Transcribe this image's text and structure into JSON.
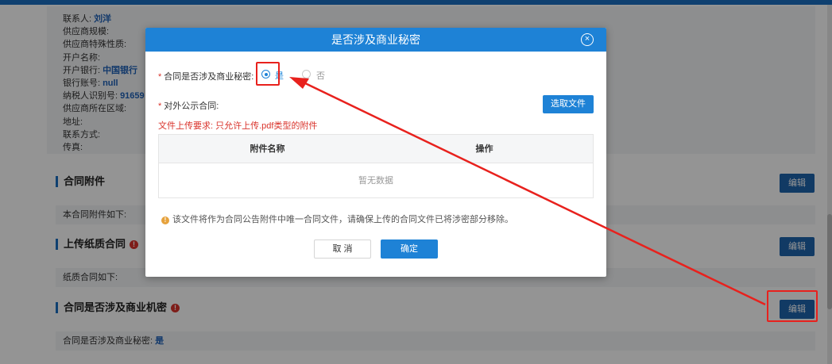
{
  "supplier_info": {
    "rows": [
      {
        "label": "联系人:",
        "value": "刘洋"
      },
      {
        "label": "供应商规模:",
        "value": ""
      },
      {
        "label": "供应商特殊性质:",
        "value": ""
      },
      {
        "label": "开户名称:",
        "value": ""
      },
      {
        "label": "开户银行:",
        "value": "中国银行"
      },
      {
        "label": "银行账号:",
        "value": "null"
      },
      {
        "label": "纳税人识别号:",
        "value": "91659"
      },
      {
        "label": "供应商所在区域:",
        "value": ""
      },
      {
        "label": "地址:",
        "value": ""
      },
      {
        "label": "联系方式:",
        "value": ""
      },
      {
        "label": "传真:",
        "value": ""
      }
    ]
  },
  "sections": {
    "attachments": {
      "title": "合同附件",
      "edit_label": "编辑",
      "summary": "本合同附件如下:"
    },
    "paper_contract": {
      "title": "上传纸质合同",
      "warn_glyph": "!",
      "edit_label": "编辑",
      "summary": "纸质合同如下:"
    },
    "trade_secret": {
      "title": "合同是否涉及商业机密",
      "warn_glyph": "!",
      "edit_label": "编辑",
      "summary_label": "合同是否涉及商业秘密:",
      "summary_value": "是"
    }
  },
  "modal": {
    "title": "是否涉及商业秘密",
    "close_glyph": "×",
    "secret_field": {
      "required_mark": "*",
      "label": "合同是否涉及商业秘密:",
      "options": [
        "是",
        "否"
      ],
      "selected": "是"
    },
    "public_field": {
      "required_mark": "*",
      "label": "对外公示合同:",
      "upload_button": "选取文件"
    },
    "upload_hint": "文件上传要求: 只允许上传.pdf类型的附件",
    "table": {
      "columns": [
        "附件名称",
        "操作"
      ],
      "empty_text": "暂无数据"
    },
    "notice_glyph": "!",
    "notice": "该文件将作为合同公告附件中唯一合同文件，请确保上传的合同文件已将涉密部分移除。",
    "cancel_label": "取 消",
    "ok_label": "确定"
  },
  "colors": {
    "primary": "#1e82d6",
    "annotation": "#e8211d",
    "danger": "#d9332b"
  }
}
